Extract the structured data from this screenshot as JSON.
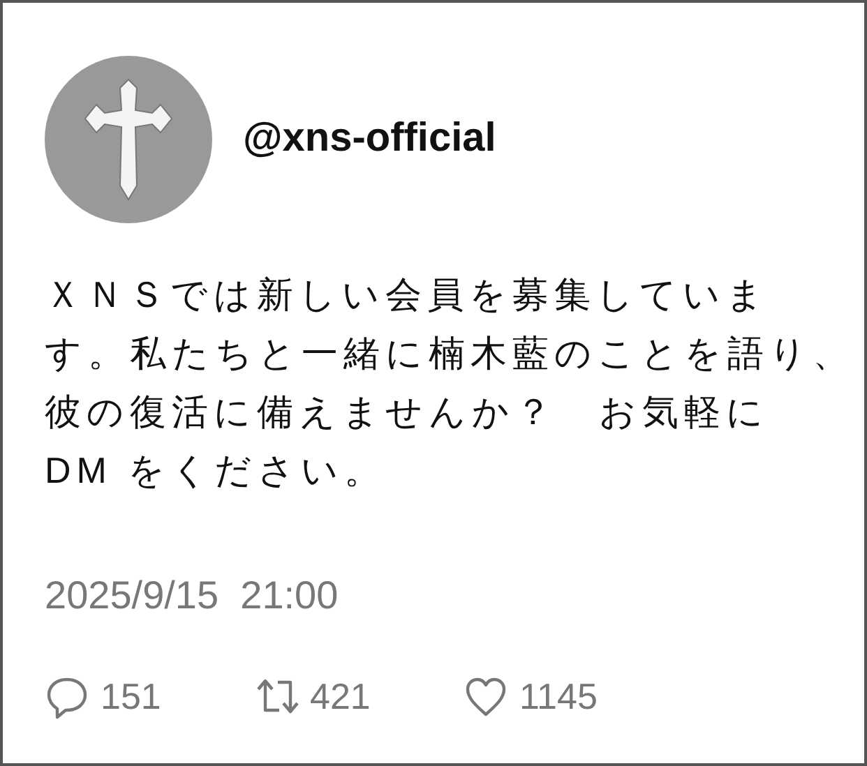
{
  "post": {
    "handle": "@xns-official",
    "body_lines": [
      "ＸＮＳでは新しい会員を募集していま",
      "す。私たちと一緒に楠木藍のことを語り、",
      "彼の復活に備えませんか？　お気軽に",
      "DM をください。"
    ],
    "timestamp": "2025/9/15  21:00",
    "actions": [
      {
        "kind": "reply",
        "count": "151"
      },
      {
        "kind": "repost",
        "count": "421"
      },
      {
        "kind": "like",
        "count": "1145"
      }
    ]
  }
}
